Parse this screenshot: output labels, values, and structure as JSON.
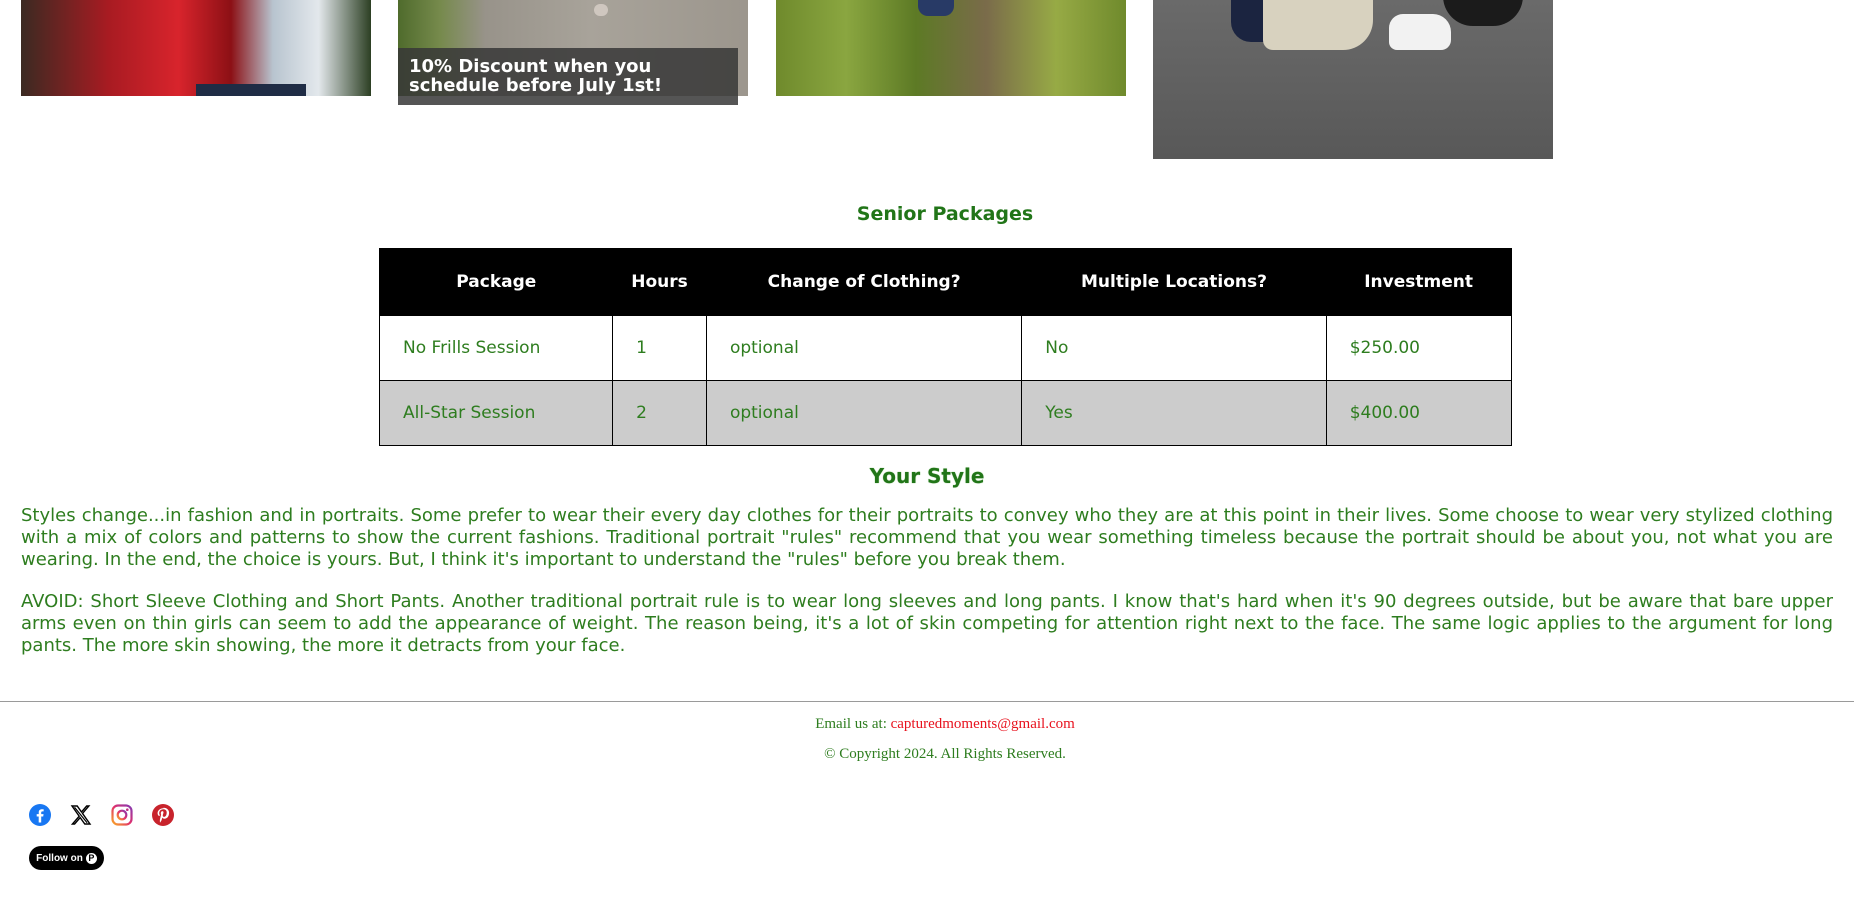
{
  "promo": {
    "discount_text": "10% Discount when you schedule before July 1st!"
  },
  "packages": {
    "title": "Senior Packages",
    "columns": [
      "Package",
      "Hours",
      "Change of Clothing?",
      "Multiple Locations?",
      "Investment"
    ],
    "rows": [
      [
        "No Frills Session",
        "1",
        "optional",
        "No",
        "$250.00"
      ],
      [
        "All-Star Session",
        "2",
        "optional",
        "Yes",
        "$400.00"
      ]
    ]
  },
  "style_section": {
    "title": "Your Style",
    "paragraphs": [
      "Styles change...in fashion and in portraits. Some prefer to wear their every day clothes for their portraits to convey who they are at this point in their lives. Some choose to wear very stylized clothing with a mix of colors and patterns to show the current fashions. Traditional portrait \"rules\" recommend that you wear something timeless because the portrait should be about you, not what you are wearing. In the end, the choice is yours. But, I think it's important to understand the \"rules\" before you break them.",
      "AVOID: Short Sleeve Clothing and Short Pants. Another traditional portrait rule is to wear long sleeves and long pants. I know that's hard when it's 90 degrees outside, but be aware that bare upper arms even on thin girls can seem to add the appearance of weight. The reason being, it's a lot of skin competing for attention right next to the face. The same logic applies to the argument for long pants. The more skin showing, the more it detracts from your face."
    ]
  },
  "footer": {
    "email_label": "Email us at: ",
    "email": "capturedmoments@gmail.com",
    "copyright": "© Copyright 2024. All Rights Reserved.",
    "follow_label": "Follow on",
    "pinterest_badge": "P",
    "social_icons": [
      "facebook-icon",
      "x-icon",
      "instagram-icon",
      "pinterest-icon"
    ]
  },
  "colors": {
    "text_green": "#2e7d1f",
    "heading_green": "#217518",
    "link_red": "#e8121e",
    "table_header_bg": "#000000",
    "alt_row_bg": "#cccccc"
  }
}
